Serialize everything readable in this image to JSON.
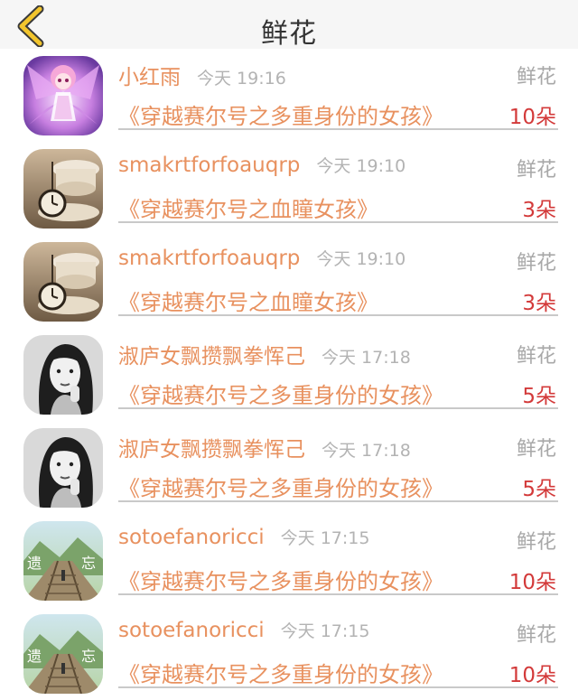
{
  "header": {
    "title": "鲜花"
  },
  "items": [
    {
      "name": "小红雨",
      "time": "今天 19:16",
      "type": "鲜花",
      "book": "《穿越赛尔号之多重身份的女孩》",
      "count": "10朵",
      "avatar": "anime-girl"
    },
    {
      "name": "smakrtforfoauqrp",
      "time": "今天 19:10",
      "type": "鲜花",
      "book": "《穿越赛尔号之血瞳女孩》",
      "count": "3朵",
      "avatar": "pocket-watch"
    },
    {
      "name": "smakrtforfoauqrp",
      "time": "今天 19:10",
      "type": "鲜花",
      "book": "《穿越赛尔号之血瞳女孩》",
      "count": "3朵",
      "avatar": "pocket-watch"
    },
    {
      "name": "淑庐女飘攒飘拳恽己",
      "time": "今天 17:18",
      "type": "鲜花",
      "book": "《穿越赛尔号之多重身份的女孩》",
      "count": "5朵",
      "avatar": "bw-portrait"
    },
    {
      "name": "淑庐女飘攒飘拳恽己",
      "time": "今天 17:18",
      "type": "鲜花",
      "book": "《穿越赛尔号之多重身份的女孩》",
      "count": "5朵",
      "avatar": "bw-portrait"
    },
    {
      "name": "sotoefanoricci",
      "time": "今天 17:15",
      "type": "鲜花",
      "book": "《穿越赛尔号之多重身份的女孩》",
      "count": "10朵",
      "avatar": "railway",
      "avatar_text": [
        "遗",
        "忘"
      ]
    },
    {
      "name": "sotoefanoricci",
      "time": "今天 17:15",
      "type": "鲜花",
      "book": "《穿越赛尔号之多重身份的女孩》",
      "count": "10朵",
      "avatar": "railway",
      "avatar_text": [
        "遗",
        "忘"
      ]
    }
  ],
  "colors": {
    "accent": "#e8915f",
    "count": "#d33a3a",
    "back_icon": "#f2c52d"
  }
}
